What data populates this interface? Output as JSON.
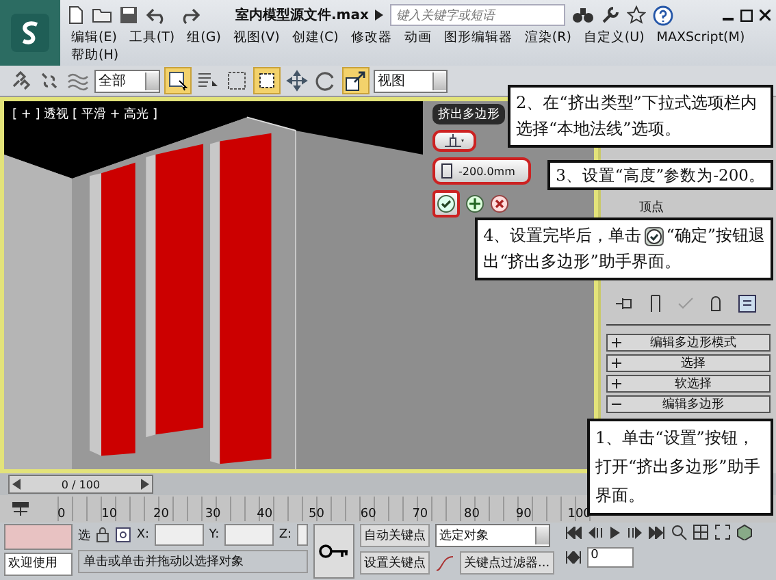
{
  "title_bar": {
    "file_name": "室内模型源文件.max",
    "search_placeholder": "键入关键字或短语"
  },
  "menu": [
    "编辑(E)",
    "工具(T)",
    "组(G)",
    "视图(V)",
    "创建(C)",
    "修改器",
    "动画",
    "图形编辑器",
    "渲染(R)",
    "自定义(U)",
    "MAXScript(M)",
    "帮助(H)"
  ],
  "toolbar": {
    "selection_filter": "全部",
    "reference_coord": "视图",
    "tools": [
      {
        "kind": "link",
        "selected": false
      },
      {
        "kind": "unlink",
        "selected": false
      },
      {
        "kind": "bind",
        "selected": false
      },
      {
        "kind": "select",
        "selected": true
      },
      {
        "kind": "select-by-name",
        "selected": false
      },
      {
        "kind": "region",
        "selected": false
      },
      {
        "kind": "window",
        "selected": true
      },
      {
        "kind": "move",
        "selected": false
      },
      {
        "kind": "rotate",
        "selected": false
      },
      {
        "kind": "scale",
        "selected": true
      }
    ]
  },
  "viewport": {
    "label": "[ + ] 透视 [ 平滑 + 高光 ]"
  },
  "caddy": {
    "title": "挤出多边形",
    "height_value": "-200.0mm"
  },
  "command_panel": {
    "tree_item": "顶点",
    "rollouts": [
      {
        "label": "编辑多边形模式",
        "expanded": false
      },
      {
        "label": "选择",
        "expanded": false
      },
      {
        "label": "软选择",
        "expanded": false
      },
      {
        "label": "编辑多边形",
        "expanded": true
      }
    ]
  },
  "time_slider": {
    "position": "0 / 100"
  },
  "ruler": {
    "ticks": [
      "0",
      "10",
      "20",
      "30",
      "40",
      "50",
      "60",
      "70",
      "80",
      "90",
      "100"
    ]
  },
  "status_bar": {
    "prompt": "欢迎使用",
    "selection_label": "选",
    "x_label": "X:",
    "y_label": "Y:",
    "z_label": "Z:",
    "message": "单击或单击并拖动以选择对象",
    "auto_key": "自动关键点",
    "set_key": "设置关键点",
    "key_mode": "选定对象",
    "key_filters": "关键点过滤器...",
    "frame": "0"
  },
  "callouts": [
    {
      "kind": "plain",
      "text": "2、在“挤出类型”下拉式选项栏内选择“本地法线”选项。"
    },
    {
      "kind": "plain",
      "text": "3、设置“高度”参数为-200。"
    },
    {
      "kind": "icon",
      "before": "4、设置完毕后，单击",
      "after": "“确定”按钮退",
      "line2": "出“挤出多边形”助手界面。"
    },
    {
      "kind": "plain",
      "text": "1、单击“设置”按钮，打开“挤出多边形”助手界面。"
    }
  ]
}
